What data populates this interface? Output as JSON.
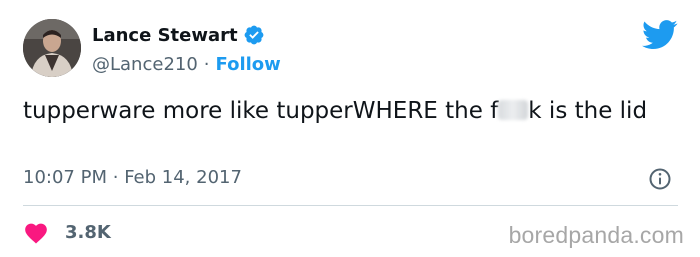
{
  "author": {
    "name": "Lance Stewart",
    "handle": "@Lance210",
    "separator": "·",
    "follow_label": "Follow",
    "verified": true
  },
  "tweet": {
    "text_before": "tupperware more like tupperWHERE the f",
    "text_after": "k is the lid",
    "time": "10:07 PM",
    "date": "Feb 14, 2017",
    "meta_separator": "·"
  },
  "engagement": {
    "likes": "3.8K"
  },
  "watermark": "boredpanda.com",
  "colors": {
    "accent": "#1d9bf0",
    "like": "#f91880",
    "text": "#0f1419",
    "secondary": "#536471"
  },
  "icons": {
    "verified": "verified-badge-icon",
    "logo": "twitter-bird-icon",
    "info": "info-icon",
    "like": "heart-icon"
  }
}
